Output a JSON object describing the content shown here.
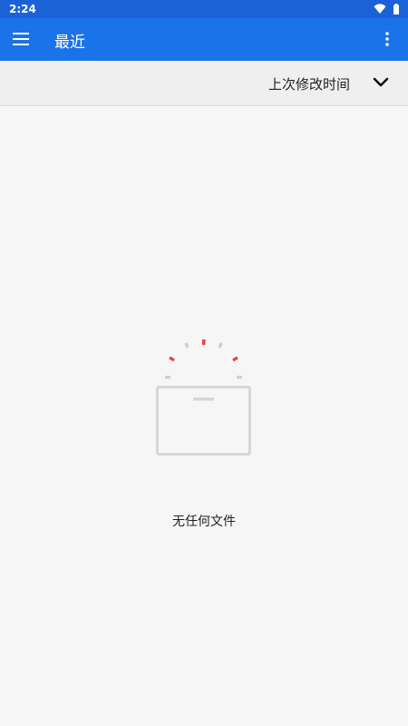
{
  "status_bar": {
    "time": "2:24",
    "icons": [
      "wifi-icon",
      "battery-icon"
    ]
  },
  "app_bar": {
    "title": "最近",
    "menu_icon": "hamburger-menu-icon",
    "more_icon": "more-vert-icon"
  },
  "sort": {
    "label": "上次修改时间",
    "icon": "chevron-down-icon"
  },
  "empty_state": {
    "message": "无任何文件",
    "icon": "empty-box-icon"
  },
  "colors": {
    "status_bar": "#1a62d6",
    "app_bar": "#1a73e8",
    "background": "#f6f6f6",
    "accent_red": "#ea4335"
  }
}
